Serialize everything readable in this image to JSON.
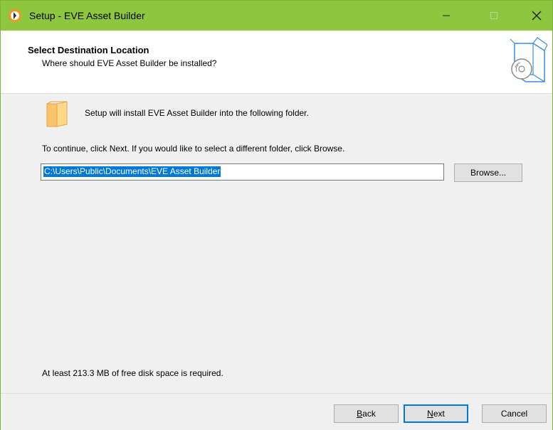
{
  "window": {
    "title": "Setup - EVE Asset Builder"
  },
  "header": {
    "title": "Select Destination Location",
    "subtitle": "Where should EVE Asset Builder be installed?"
  },
  "content": {
    "install_text": "Setup will install EVE Asset Builder into the following folder.",
    "continue_text": "To continue, click Next. If you would like to select a different folder, click Browse.",
    "path_value": "C:\\Users\\Public\\Documents\\EVE Asset Builder",
    "browse_label": "Browse...",
    "disk_space_text": "At least 213.3 MB of free disk space is required."
  },
  "footer": {
    "back_access": "B",
    "back_rest": "ack",
    "next_access": "N",
    "next_rest": "ext",
    "cancel_label": "Cancel"
  },
  "colors": {
    "titlebar": "#8dc63f",
    "accent": "#0078d7"
  }
}
